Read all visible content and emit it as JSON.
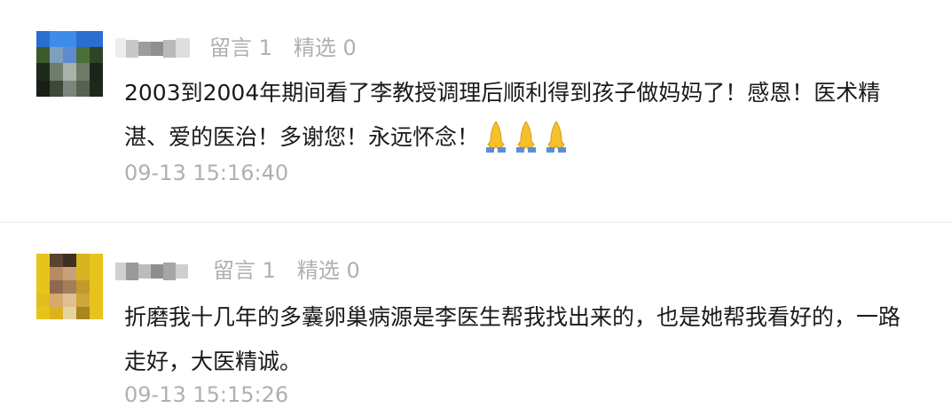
{
  "comments": [
    {
      "likes_label": "留言 1",
      "featured_label": "精选 0",
      "text": "2003到2004年期间看了李教授调理后顺利得到孩子做妈妈了！感恩！医术精湛、爱的医治！多谢您！永远怀念！",
      "emoji": "pray-hands-icon x3",
      "time": "09-13 15:16:40"
    },
    {
      "likes_label": "留言 1",
      "featured_label": "精选 0",
      "text": "折磨我十几年的多囊卵巢病源是李医生帮我找出来的，也是她帮我看好的，一路走好，大医精诚。",
      "time": "09-13 15:15:26"
    }
  ],
  "colors": {
    "meta_text": "#b0b0b0",
    "body_text": "#1a1a1a",
    "divider": "#e6e6e6",
    "avatar2_bg": "#e8c31c"
  }
}
